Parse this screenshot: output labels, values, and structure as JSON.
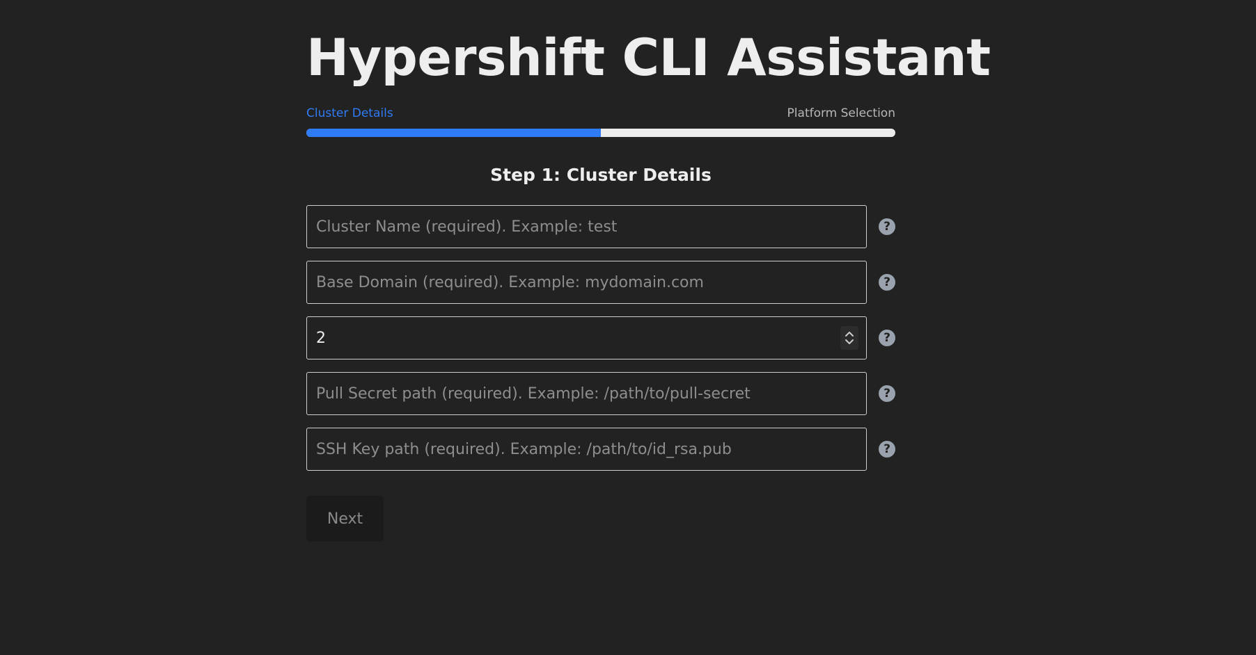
{
  "app": {
    "title": "Hypershift CLI Assistant"
  },
  "progress": {
    "steps": [
      {
        "label": "Cluster Details",
        "active": true
      },
      {
        "label": "Platform Selection",
        "active": false
      }
    ],
    "fill_fraction": 0.5,
    "accent_color": "#2f7cf6",
    "track_color": "#ededed"
  },
  "form": {
    "heading": "Step 1: Cluster Details",
    "fields": {
      "cluster_name": {
        "placeholder": "Cluster Name (required). Example: test",
        "value": ""
      },
      "base_domain": {
        "placeholder": "Base Domain (required). Example: mydomain.com",
        "value": ""
      },
      "node_count": {
        "value": "2"
      },
      "pull_secret": {
        "placeholder": "Pull Secret path (required). Example: /path/to/pull-secret",
        "value": ""
      },
      "ssh_key": {
        "placeholder": "SSH Key path (required). Example: /path/to/id_rsa.pub",
        "value": ""
      }
    },
    "help_glyph": "?",
    "help_icon": "question-circle-icon",
    "next_label": "Next"
  }
}
